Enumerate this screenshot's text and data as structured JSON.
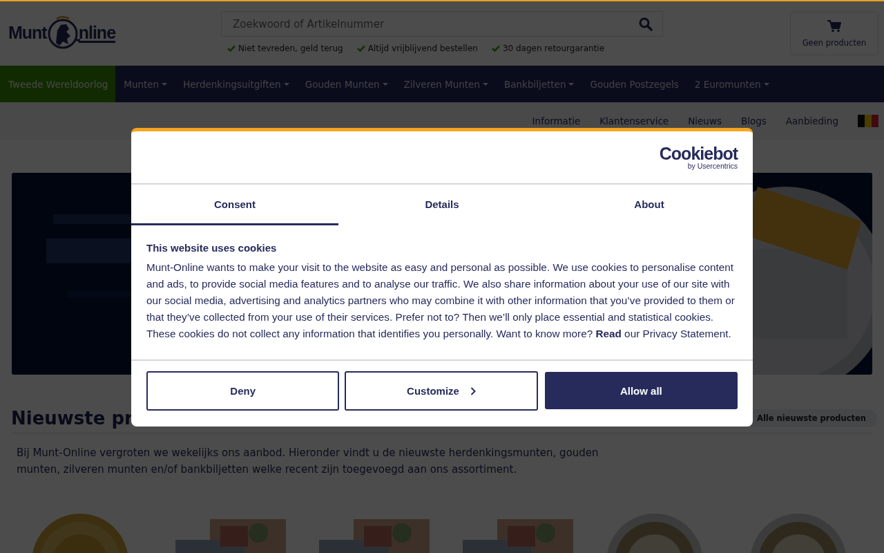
{
  "header": {
    "logo": {
      "left": "Munt",
      "right": "nline"
    },
    "search": {
      "placeholder": "Zoekwoord of Artikelnummer"
    },
    "usps": [
      "Niet tevreden, geld terug",
      "Altijd vrijblijvend bestellen",
      "30 dagen retourgarantie"
    ],
    "cart": {
      "label": "Geen producten"
    }
  },
  "main_nav": [
    {
      "label": "Tweede Wereldoorlog",
      "has_menu": false,
      "highlighted": true
    },
    {
      "label": "Munten",
      "has_menu": true,
      "highlighted": false
    },
    {
      "label": "Herdenkingsuitgiften",
      "has_menu": true,
      "highlighted": false
    },
    {
      "label": "Gouden Munten",
      "has_menu": true,
      "highlighted": false
    },
    {
      "label": "Zilveren Munten",
      "has_menu": true,
      "highlighted": false
    },
    {
      "label": "Bankbiljetten",
      "has_menu": true,
      "highlighted": false
    },
    {
      "label": "Gouden Postzegels",
      "has_menu": false,
      "highlighted": false
    },
    {
      "label": "2 Euromunten",
      "has_menu": true,
      "highlighted": false
    }
  ],
  "secondary_nav": [
    "Informatie",
    "Klantenservice",
    "Nieuws",
    "Blogs",
    "Aanbieding"
  ],
  "banner": {
    "kind": "picture"
  },
  "newest": {
    "title": "Nieuwste pr",
    "button": "Alle nieuwste producten",
    "intro": "Bij Munt-Online vergroten we wekelijks ons aanbod. Hieronder vindt u de nieuwste herdenkingsmunten, gouden munten, zilveren munten en/of bankbiljetten welke recent zijn toegevoegd aan ons assortiment.",
    "products": [
      {
        "kind": "coin"
      },
      {
        "kind": "banknote"
      },
      {
        "kind": "banknote"
      },
      {
        "kind": "banknote"
      },
      {
        "kind": "coin"
      },
      {
        "kind": "coin"
      }
    ]
  },
  "cookie_dialog": {
    "brand": {
      "name": "Cookiebot",
      "byline": "by Usercentrics"
    },
    "tabs": [
      {
        "label": "Consent",
        "selected": true
      },
      {
        "label": "Details",
        "selected": false
      },
      {
        "label": "About",
        "selected": false
      }
    ],
    "title": "This website uses cookies",
    "text": "Munt-Online wants to make your visit to the website as easy and personal as possible. We use cookies to personalise content and ads, to provide social media features and to analyse our traffic. We also share information about your use of our site with our social media, advertising and analytics partners who may combine it with other information that you’ve provided to them or that they’ve collected from your use of their services. Prefer not to? Then we’ll only place essential and statistical cookies. These cookies do not collect any information that identifies you personally. Want to know more? **Read** our Privacy Statement.",
    "buttons": [
      {
        "label": "Deny",
        "kind": "outline"
      },
      {
        "label": "Customize",
        "kind": "more"
      },
      {
        "label": "Allow all",
        "kind": "primary"
      }
    ]
  }
}
